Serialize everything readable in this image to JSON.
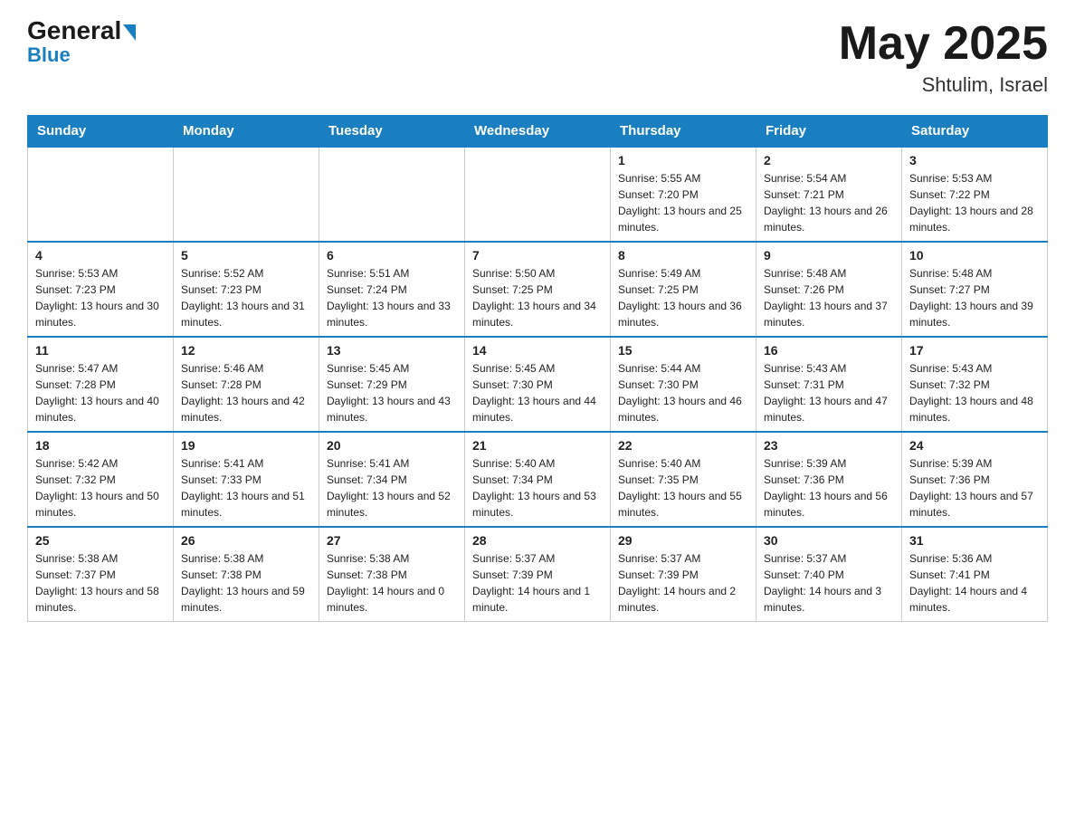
{
  "header": {
    "logo_general": "General",
    "logo_blue": "Blue",
    "month_year": "May 2025",
    "location": "Shtulim, Israel"
  },
  "days_of_week": [
    "Sunday",
    "Monday",
    "Tuesday",
    "Wednesday",
    "Thursday",
    "Friday",
    "Saturday"
  ],
  "weeks": [
    [
      {
        "day": "",
        "info": ""
      },
      {
        "day": "",
        "info": ""
      },
      {
        "day": "",
        "info": ""
      },
      {
        "day": "",
        "info": ""
      },
      {
        "day": "1",
        "info": "Sunrise: 5:55 AM\nSunset: 7:20 PM\nDaylight: 13 hours and 25 minutes."
      },
      {
        "day": "2",
        "info": "Sunrise: 5:54 AM\nSunset: 7:21 PM\nDaylight: 13 hours and 26 minutes."
      },
      {
        "day": "3",
        "info": "Sunrise: 5:53 AM\nSunset: 7:22 PM\nDaylight: 13 hours and 28 minutes."
      }
    ],
    [
      {
        "day": "4",
        "info": "Sunrise: 5:53 AM\nSunset: 7:23 PM\nDaylight: 13 hours and 30 minutes."
      },
      {
        "day": "5",
        "info": "Sunrise: 5:52 AM\nSunset: 7:23 PM\nDaylight: 13 hours and 31 minutes."
      },
      {
        "day": "6",
        "info": "Sunrise: 5:51 AM\nSunset: 7:24 PM\nDaylight: 13 hours and 33 minutes."
      },
      {
        "day": "7",
        "info": "Sunrise: 5:50 AM\nSunset: 7:25 PM\nDaylight: 13 hours and 34 minutes."
      },
      {
        "day": "8",
        "info": "Sunrise: 5:49 AM\nSunset: 7:25 PM\nDaylight: 13 hours and 36 minutes."
      },
      {
        "day": "9",
        "info": "Sunrise: 5:48 AM\nSunset: 7:26 PM\nDaylight: 13 hours and 37 minutes."
      },
      {
        "day": "10",
        "info": "Sunrise: 5:48 AM\nSunset: 7:27 PM\nDaylight: 13 hours and 39 minutes."
      }
    ],
    [
      {
        "day": "11",
        "info": "Sunrise: 5:47 AM\nSunset: 7:28 PM\nDaylight: 13 hours and 40 minutes."
      },
      {
        "day": "12",
        "info": "Sunrise: 5:46 AM\nSunset: 7:28 PM\nDaylight: 13 hours and 42 minutes."
      },
      {
        "day": "13",
        "info": "Sunrise: 5:45 AM\nSunset: 7:29 PM\nDaylight: 13 hours and 43 minutes."
      },
      {
        "day": "14",
        "info": "Sunrise: 5:45 AM\nSunset: 7:30 PM\nDaylight: 13 hours and 44 minutes."
      },
      {
        "day": "15",
        "info": "Sunrise: 5:44 AM\nSunset: 7:30 PM\nDaylight: 13 hours and 46 minutes."
      },
      {
        "day": "16",
        "info": "Sunrise: 5:43 AM\nSunset: 7:31 PM\nDaylight: 13 hours and 47 minutes."
      },
      {
        "day": "17",
        "info": "Sunrise: 5:43 AM\nSunset: 7:32 PM\nDaylight: 13 hours and 48 minutes."
      }
    ],
    [
      {
        "day": "18",
        "info": "Sunrise: 5:42 AM\nSunset: 7:32 PM\nDaylight: 13 hours and 50 minutes."
      },
      {
        "day": "19",
        "info": "Sunrise: 5:41 AM\nSunset: 7:33 PM\nDaylight: 13 hours and 51 minutes."
      },
      {
        "day": "20",
        "info": "Sunrise: 5:41 AM\nSunset: 7:34 PM\nDaylight: 13 hours and 52 minutes."
      },
      {
        "day": "21",
        "info": "Sunrise: 5:40 AM\nSunset: 7:34 PM\nDaylight: 13 hours and 53 minutes."
      },
      {
        "day": "22",
        "info": "Sunrise: 5:40 AM\nSunset: 7:35 PM\nDaylight: 13 hours and 55 minutes."
      },
      {
        "day": "23",
        "info": "Sunrise: 5:39 AM\nSunset: 7:36 PM\nDaylight: 13 hours and 56 minutes."
      },
      {
        "day": "24",
        "info": "Sunrise: 5:39 AM\nSunset: 7:36 PM\nDaylight: 13 hours and 57 minutes."
      }
    ],
    [
      {
        "day": "25",
        "info": "Sunrise: 5:38 AM\nSunset: 7:37 PM\nDaylight: 13 hours and 58 minutes."
      },
      {
        "day": "26",
        "info": "Sunrise: 5:38 AM\nSunset: 7:38 PM\nDaylight: 13 hours and 59 minutes."
      },
      {
        "day": "27",
        "info": "Sunrise: 5:38 AM\nSunset: 7:38 PM\nDaylight: 14 hours and 0 minutes."
      },
      {
        "day": "28",
        "info": "Sunrise: 5:37 AM\nSunset: 7:39 PM\nDaylight: 14 hours and 1 minute."
      },
      {
        "day": "29",
        "info": "Sunrise: 5:37 AM\nSunset: 7:39 PM\nDaylight: 14 hours and 2 minutes."
      },
      {
        "day": "30",
        "info": "Sunrise: 5:37 AM\nSunset: 7:40 PM\nDaylight: 14 hours and 3 minutes."
      },
      {
        "day": "31",
        "info": "Sunrise: 5:36 AM\nSunset: 7:41 PM\nDaylight: 14 hours and 4 minutes."
      }
    ]
  ]
}
